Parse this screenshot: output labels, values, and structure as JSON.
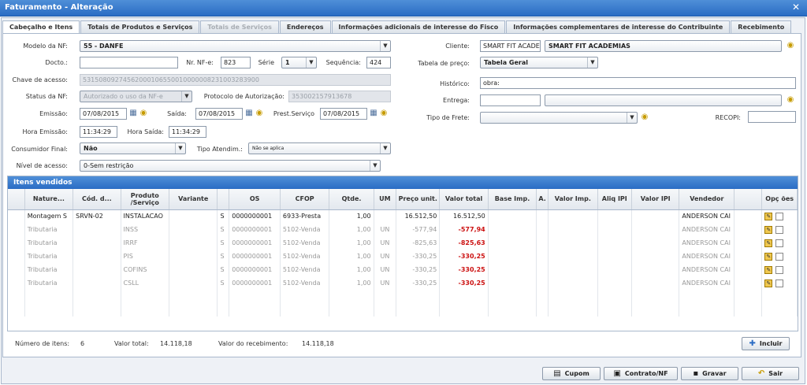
{
  "window": {
    "title": "Faturamento - Alteração",
    "close": "✕"
  },
  "tabs": [
    "Cabeçalho e Itens",
    "Totais de Produtos e Serviços",
    "Totais de Serviços",
    "Endereços",
    "Informações adicionais de interesse do Fisco",
    "Informações complementares de interesse do Contribuinte",
    "Recebimento"
  ],
  "form": {
    "modelo_label": "Modelo da NF:",
    "modelo_value": "55 - DANFE",
    "docto_label": "Docto.:",
    "docto_value": "",
    "nrnfe_label": "Nr. NF-e:",
    "nrnfe_value": "823",
    "serie_label": "Série",
    "serie_value": "1",
    "sequencia_label": "Sequência:",
    "sequencia_value": "424",
    "chave_label": "Chave de acesso:",
    "chave_value": "53150809274562000106550010000008231003283900",
    "status_label": "Status da NF:",
    "status_value": "Autorizado o uso da NF-e",
    "protocolo_label": "Protocolo de Autorização:",
    "protocolo_value": "353002157913678",
    "emissao_label": "Emissão:",
    "emissao_value": "07/08/2015",
    "saida_label": "Saída:",
    "saida_value": "07/08/2015",
    "prest_label": "Prest.Serviço",
    "prest_value": "07/08/2015",
    "hora_emissao_label": "Hora Emissão:",
    "hora_emissao_value": "11:34:29",
    "hora_saida_label": "Hora Saída:",
    "hora_saida_value": "11:34:29",
    "consumidor_label": "Consumidor Final:",
    "consumidor_value": "Não",
    "tipo_atend_label": "Tipo Atendim.:",
    "tipo_atend_value": "Não se aplica",
    "nivel_label": "Nível de acesso:",
    "nivel_value": "0-Sem restrição",
    "cliente_label": "Cliente:",
    "cliente_code": "SMART FIT ACADEMIAS",
    "cliente_name": "SMART FIT ACADEMIAS",
    "tabela_label": "Tabela de preço:",
    "tabela_value": "Tabela Geral",
    "historico_label": "Histórico:",
    "historico_value": "obra:",
    "entrega_label": "Entrega:",
    "entrega_value": "",
    "frete_label": "Tipo de Frete:",
    "frete_value": "",
    "recopi_label": "RECOPI:",
    "recopi_value": ""
  },
  "grid": {
    "title": "Itens vendidos",
    "headers": [
      "Nature...",
      "Cód. d...",
      "Produto /Serviço",
      "Variante",
      "",
      "OS",
      "CFOP",
      "Qtde.",
      "UM",
      "Preço unit.",
      "Valor total",
      "Base Imp.",
      "A.",
      "Valor Imp.",
      "Aliq IPI",
      "Valor IPI",
      "Vendedor",
      "",
      "Opç ões"
    ],
    "rows": [
      {
        "nat": "Montagem S",
        "cod": "SRVN-02",
        "prod": "INSTALACAO",
        "var": "",
        "s": "S",
        "os": "0000000001",
        "cfop": "6933-Presta",
        "qtde": "1,00",
        "um": "",
        "preco": "16.512,50",
        "total": "16.512,50",
        "vend": "ANDERSON CAI"
      },
      {
        "nat": "Tributaria",
        "cod": "",
        "prod": "INSS",
        "var": "",
        "s": "S",
        "os": "0000000001",
        "cfop": "5102-Venda",
        "qtde": "1,00",
        "um": "UN",
        "preco": "-577,94",
        "total": "-577,94",
        "vend": "ANDERSON CAI"
      },
      {
        "nat": "Tributaria",
        "cod": "",
        "prod": "IRRF",
        "var": "",
        "s": "S",
        "os": "0000000001",
        "cfop": "5102-Venda",
        "qtde": "1,00",
        "um": "UN",
        "preco": "-825,63",
        "total": "-825,63",
        "vend": "ANDERSON CAI"
      },
      {
        "nat": "Tributaria",
        "cod": "",
        "prod": "PIS",
        "var": "",
        "s": "S",
        "os": "0000000001",
        "cfop": "5102-Venda",
        "qtde": "1,00",
        "um": "UN",
        "preco": "-330,25",
        "total": "-330,25",
        "vend": "ANDERSON CAI"
      },
      {
        "nat": "Tributaria",
        "cod": "",
        "prod": "COFINS",
        "var": "",
        "s": "S",
        "os": "0000000001",
        "cfop": "5102-Venda",
        "qtde": "1,00",
        "um": "UN",
        "preco": "-330,25",
        "total": "-330,25",
        "vend": "ANDERSON CAI"
      },
      {
        "nat": "Tributaria",
        "cod": "",
        "prod": "CSLL",
        "var": "",
        "s": "S",
        "os": "0000000001",
        "cfop": "5102-Venda",
        "qtde": "1,00",
        "um": "UN",
        "preco": "-330,25",
        "total": "-330,25",
        "vend": "ANDERSON CAI"
      }
    ]
  },
  "footer": {
    "num_itens_label": "Número de itens:",
    "num_itens": "6",
    "valor_total_label": "Valor total:",
    "valor_total": "14.118,18",
    "valor_receb_label": "Valor do recebimento:",
    "valor_receb": "14.118,18",
    "incluir": "Incluir"
  },
  "buttons": {
    "cupom": "Cupom",
    "contrato": "Contrato/NF",
    "gravar": "Gravar",
    "sair": "Sair"
  }
}
